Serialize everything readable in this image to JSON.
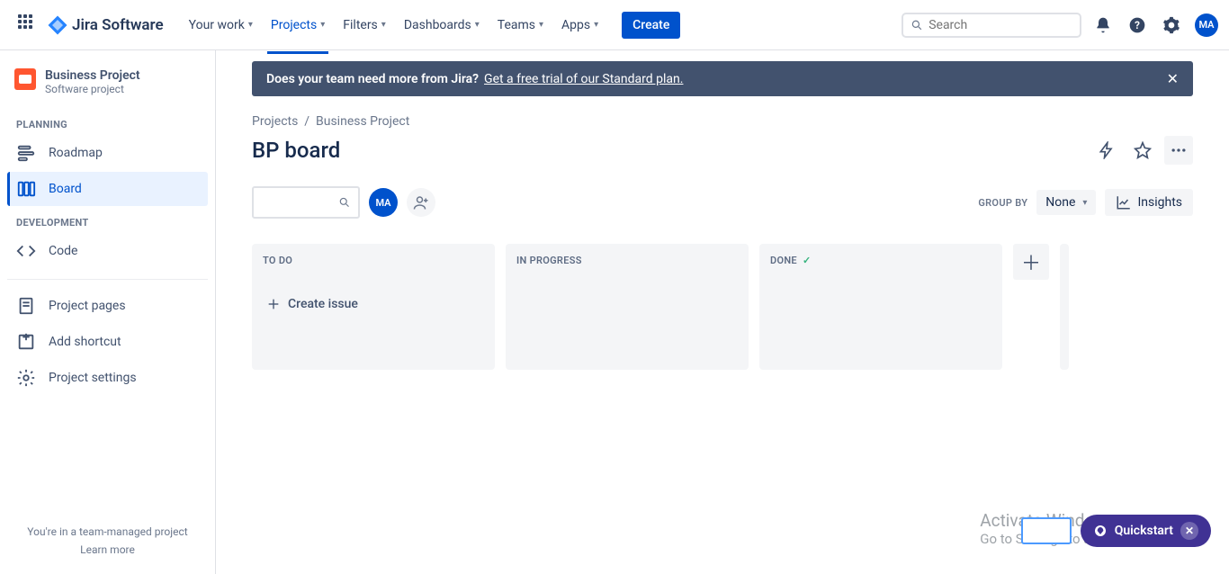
{
  "header": {
    "logo_text": "Jira Software",
    "nav": {
      "your_work": "Your work",
      "projects": "Projects",
      "filters": "Filters",
      "dashboards": "Dashboards",
      "teams": "Teams",
      "apps": "Apps"
    },
    "create_label": "Create",
    "search_placeholder": "Search",
    "avatar_initials": "MA"
  },
  "sidebar": {
    "project_name": "Business Project",
    "project_type": "Software project",
    "sections": {
      "planning": "PLANNING",
      "development": "DEVELOPMENT"
    },
    "items": {
      "roadmap": "Roadmap",
      "board": "Board",
      "code": "Code",
      "project_pages": "Project pages",
      "add_shortcut": "Add shortcut",
      "project_settings": "Project settings"
    },
    "footer_text": "You're in a team-managed project",
    "footer_link": "Learn more"
  },
  "banner": {
    "lead": "Does your team need more from Jira?",
    "link": "Get a free trial of our Standard plan."
  },
  "breadcrumbs": {
    "root": "Projects",
    "current": "Business Project"
  },
  "page_title": "BP board",
  "controls": {
    "groupby_label": "GROUP BY",
    "groupby_value": "None",
    "insights_label": "Insights",
    "avatar_initials": "MA"
  },
  "columns": {
    "todo": "TO DO",
    "inprogress": "IN PROGRESS",
    "done": "DONE",
    "create_issue": "Create issue"
  },
  "overlay": {
    "activate_title": "Activate Windows",
    "activate_sub": "Go to Settings to activate Windows.",
    "quickstart": "Quickstart"
  }
}
